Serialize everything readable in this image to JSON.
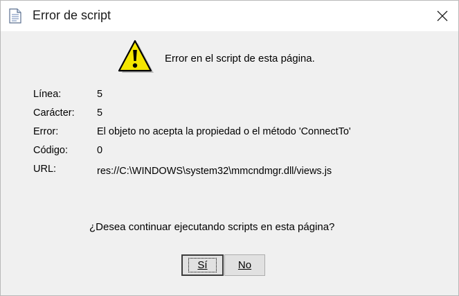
{
  "window": {
    "title": "Error de script"
  },
  "icons": {
    "title": "document-icon",
    "close": "close-icon",
    "warning": "warning-icon"
  },
  "message": {
    "headline": "Error en el script de esta página."
  },
  "details": [
    {
      "label": "Línea:",
      "value": "5"
    },
    {
      "label": "Carácter:",
      "value": "5"
    },
    {
      "label": "Error:",
      "value": "El objeto no acepta la propiedad o el método 'ConnectTo'"
    },
    {
      "label": "Código:",
      "value": "0"
    },
    {
      "label": "URL:",
      "value": "res://C:\\WINDOWS\\system32\\mmcndmgr.dll/views.js"
    }
  ],
  "question": "¿Desea continuar ejecutando scripts en esta página?",
  "buttons": {
    "yes": "Sí",
    "no": "No"
  },
  "colors": {
    "warning_fill": "#f5e600",
    "window_bg": "#f0f0f0",
    "titlebar_bg": "#ffffff"
  }
}
